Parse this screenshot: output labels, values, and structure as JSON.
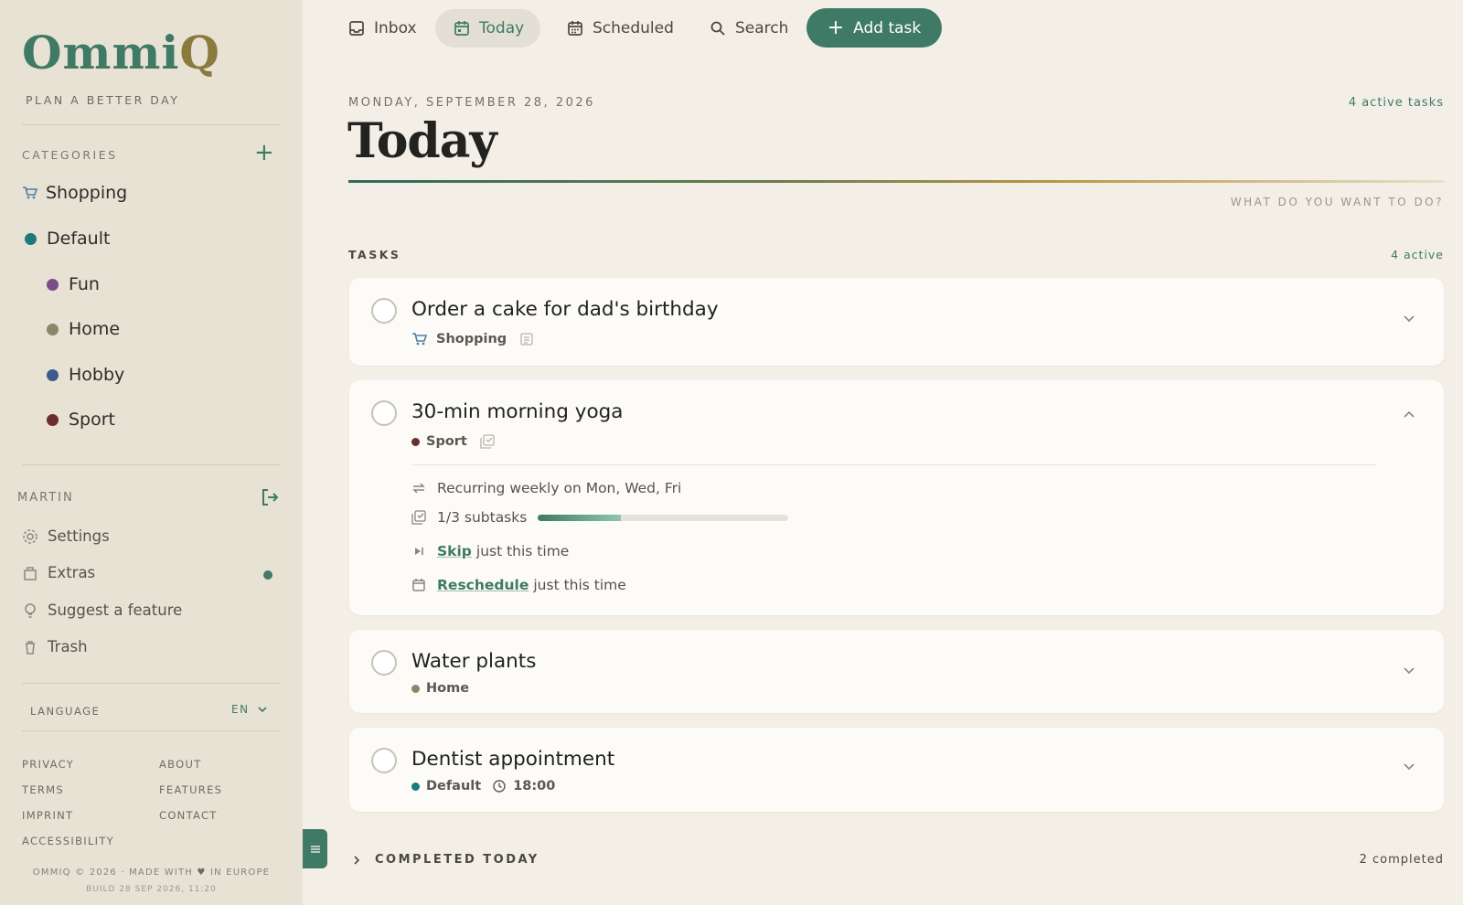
{
  "brand": {
    "logo_main": "Ommi",
    "logo_q": "Q",
    "tagline": "PLAN A BETTER DAY"
  },
  "sidebar": {
    "categories_header": "CATEGORIES",
    "add_category_glyph": "+",
    "categories": [
      {
        "label": "Shopping",
        "icon": "cart-icon"
      },
      {
        "label": "Default",
        "color": "#1b7a7a"
      },
      {
        "label": "Fun",
        "color": "#7a4d86"
      },
      {
        "label": "Home",
        "color": "#878867"
      },
      {
        "label": "Hobby",
        "color": "#3d5a8e"
      },
      {
        "label": "Sport",
        "color": "#6b2e2e"
      }
    ],
    "user_name": "MARTIN",
    "menu": [
      {
        "label": "Settings",
        "icon": "gear-icon"
      },
      {
        "label": "Extras",
        "icon": "gift-icon"
      },
      {
        "label": "Suggest a feature",
        "icon": "lightbulb-icon"
      },
      {
        "label": "Trash",
        "icon": "trash-icon"
      }
    ],
    "language_label": "LANGUAGE",
    "language_value": "EN",
    "footer_links_left": [
      "PRIVACY",
      "TERMS",
      "IMPRINT",
      "ACCESSIBILITY"
    ],
    "footer_links_right": [
      "ABOUT",
      "FEATURES",
      "CONTACT"
    ],
    "copyright_before": "OMMIQ © 2026 · MADE WITH",
    "copyright_after": "IN EUROPE",
    "build": "BUILD 28 SEP 2026, 11:20"
  },
  "nav": {
    "inbox": "Inbox",
    "today": "Today",
    "scheduled": "Scheduled",
    "search": "Search",
    "add_task": "Add task"
  },
  "header": {
    "date": "MONDAY, SEPTEMBER 28, 2026",
    "active_tasks": "4 active tasks",
    "title": "Today",
    "prompt": "WHAT DO YOU WANT TO DO?"
  },
  "tasks_section": {
    "label": "TASKS",
    "count": "4 active",
    "items": [
      {
        "title": "Order a cake for dad's birthday",
        "category": "Shopping",
        "category_icon": "cart-icon",
        "has_note": true,
        "expanded": false
      },
      {
        "title": "30-min morning yoga",
        "category": "Sport",
        "category_color": "#6b2e2e",
        "expanded": true,
        "details": {
          "recurring": "Recurring weekly on Mon, Wed, Fri",
          "subtasks": "1/3 subtasks",
          "subtask_progress": 0.33,
          "skip_link": "Skip",
          "skip_text": "just this time",
          "reschedule_link": "Reschedule",
          "reschedule_text": "just this time"
        }
      },
      {
        "title": "Water plants",
        "category": "Home",
        "category_color": "#878867",
        "expanded": false
      },
      {
        "title": "Dentist appointment",
        "category": "Default",
        "category_color": "#1b7a7a",
        "time": "18:00",
        "expanded": false
      }
    ]
  },
  "completed": {
    "label": "COMPLETED TODAY",
    "count": "2 completed"
  },
  "colors": {
    "accent": "#3f7a66",
    "sidebar_bg": "#e8e2d5",
    "page_bg": "#f3efe6"
  }
}
